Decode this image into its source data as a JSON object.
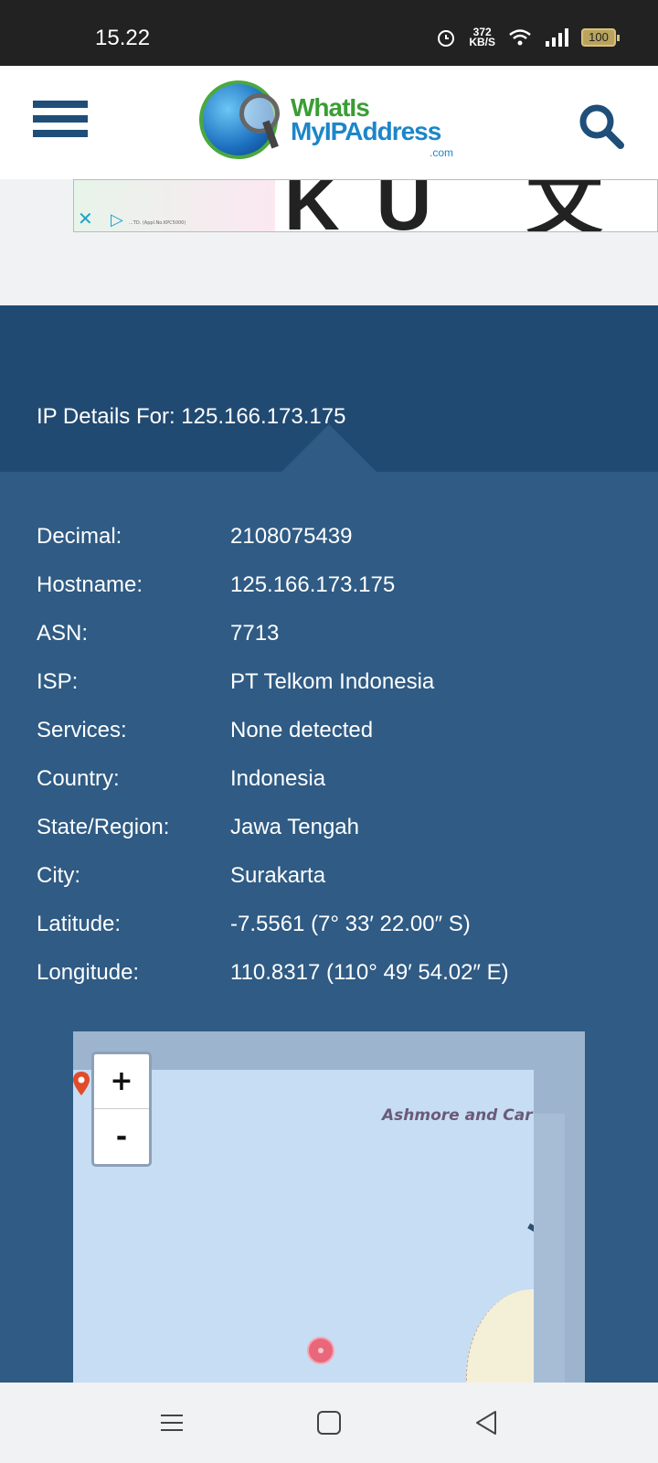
{
  "status_bar": {
    "time": "15.22",
    "speed_value": "372",
    "speed_unit": "KB/S",
    "battery": "100"
  },
  "header": {
    "logo_line1": "WhatIs",
    "logo_line2": "MyIPAddress",
    "logo_line3": ".com"
  },
  "ad": {
    "big_text": "KU 文 日",
    "small_print": "...TD. (Appl.No.KPC5000)"
  },
  "ip_details": {
    "title": "IP Details For: 125.166.173.175",
    "rows": [
      {
        "label": "Decimal:",
        "value": "2108075439"
      },
      {
        "label": "Hostname:",
        "value": "125.166.173.175"
      },
      {
        "label": "ASN:",
        "value": "7713"
      },
      {
        "label": "ISP:",
        "value": "PT Telkom Indonesia"
      },
      {
        "label": "Services:",
        "value": "None detected"
      },
      {
        "label": "Country:",
        "value": "Indonesia"
      },
      {
        "label": "State/Region:",
        "value": "Jawa Tengah"
      },
      {
        "label": "City:",
        "value": "Surakarta"
      },
      {
        "label": "Latitude:",
        "value": "-7.5561 (7° 33′ 22.00″ S)"
      },
      {
        "label": "Longitude:",
        "value": "110.8317 (110° 49′ 54.02″ E)"
      }
    ]
  },
  "map": {
    "label": "Ashmore and Car",
    "zoom_in": "+",
    "zoom_out": "-"
  },
  "colors": {
    "header_blue": "#214a72",
    "body_blue": "#2f5b84",
    "brand_blue": "#1f4e79"
  }
}
